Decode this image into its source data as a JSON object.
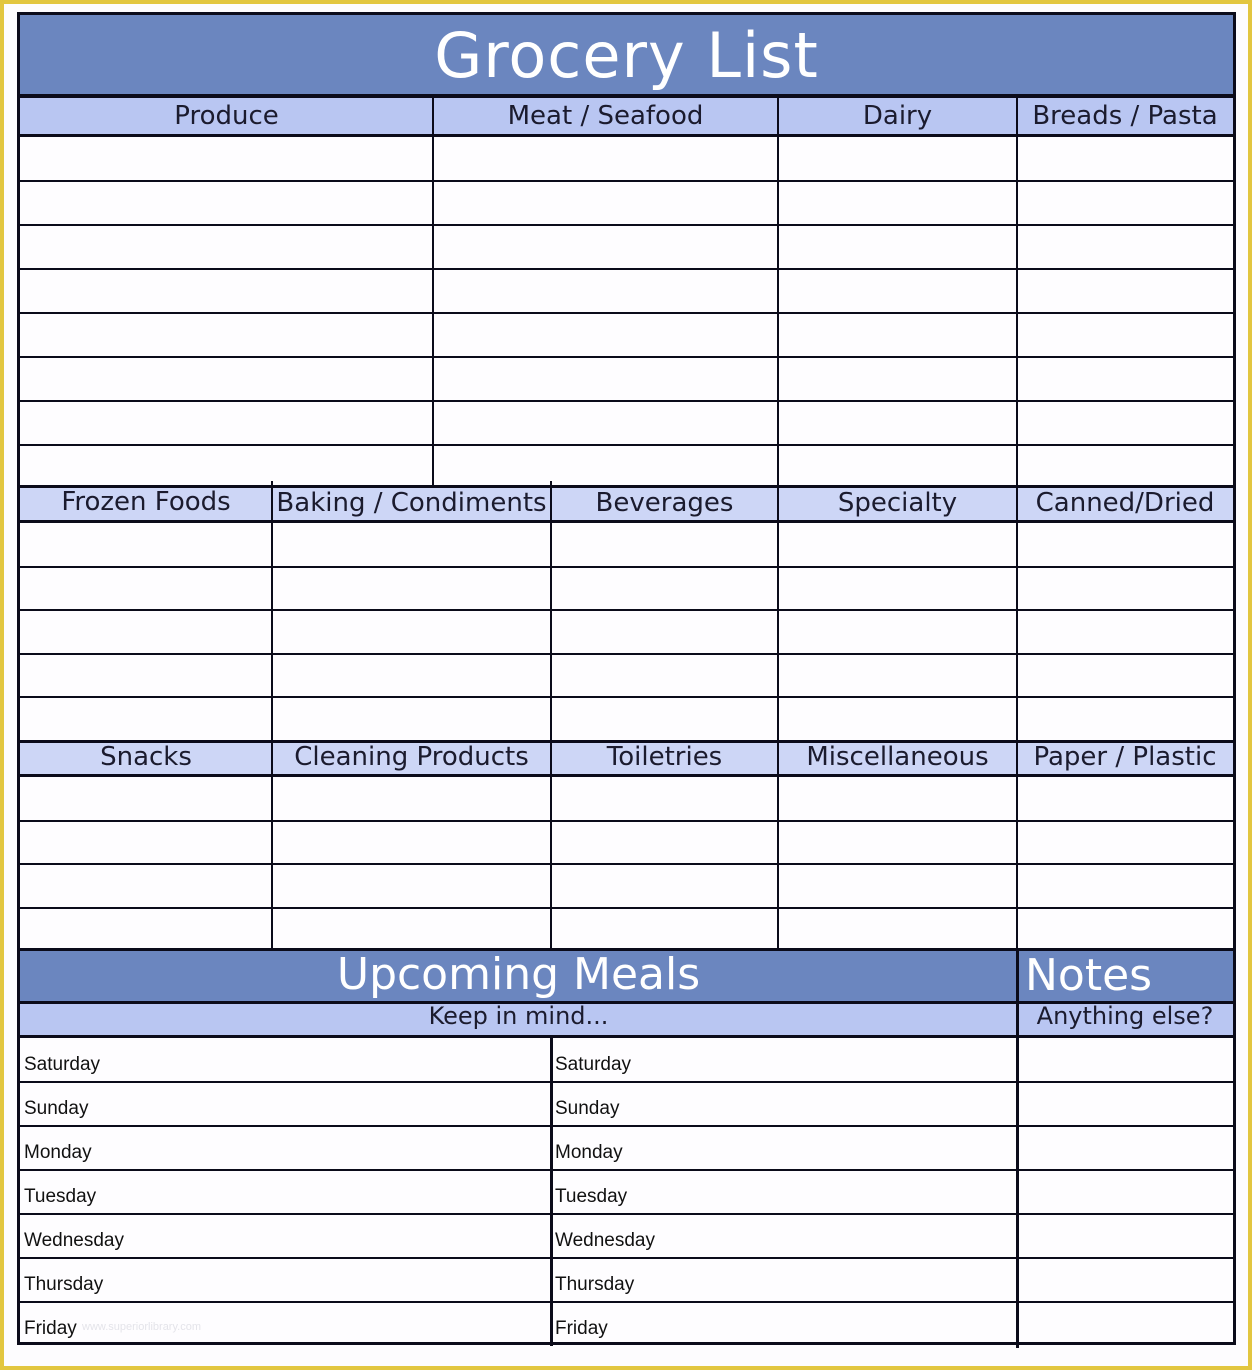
{
  "title": "Grocery List",
  "sections": [
    {
      "categories": [
        "Produce",
        "Meat / Seafood",
        "Dairy",
        "Breads / Pasta"
      ],
      "rows": 8
    },
    {
      "categories": [
        "Frozen Foods",
        "Baking / Condiments",
        "Beverages",
        "Specialty",
        "Canned/Dried"
      ],
      "rows": 5
    },
    {
      "categories": [
        "Snacks",
        "Cleaning Products",
        "Toiletries",
        "Miscellaneous",
        "Paper / Plastic"
      ],
      "rows": 4
    }
  ],
  "meals": {
    "title": "Upcoming Meals",
    "subtitle": "Keep in mind...",
    "days_left": [
      "Saturday",
      "Sunday",
      "Monday",
      "Tuesday",
      "Wednesday",
      "Thursday",
      "Friday"
    ],
    "days_right": [
      "Saturday",
      "Sunday",
      "Monday",
      "Tuesday",
      "Wednesday",
      "Thursday",
      "Friday"
    ]
  },
  "notes": {
    "title": "Notes",
    "subtitle": "Anything else?"
  },
  "watermark": "www.superiorlibrary.com",
  "colors": {
    "frame": "#e2c640",
    "header_dark": "#6b86bf",
    "header_light": "#b9c6f2",
    "grid": "#0b0b1a"
  }
}
